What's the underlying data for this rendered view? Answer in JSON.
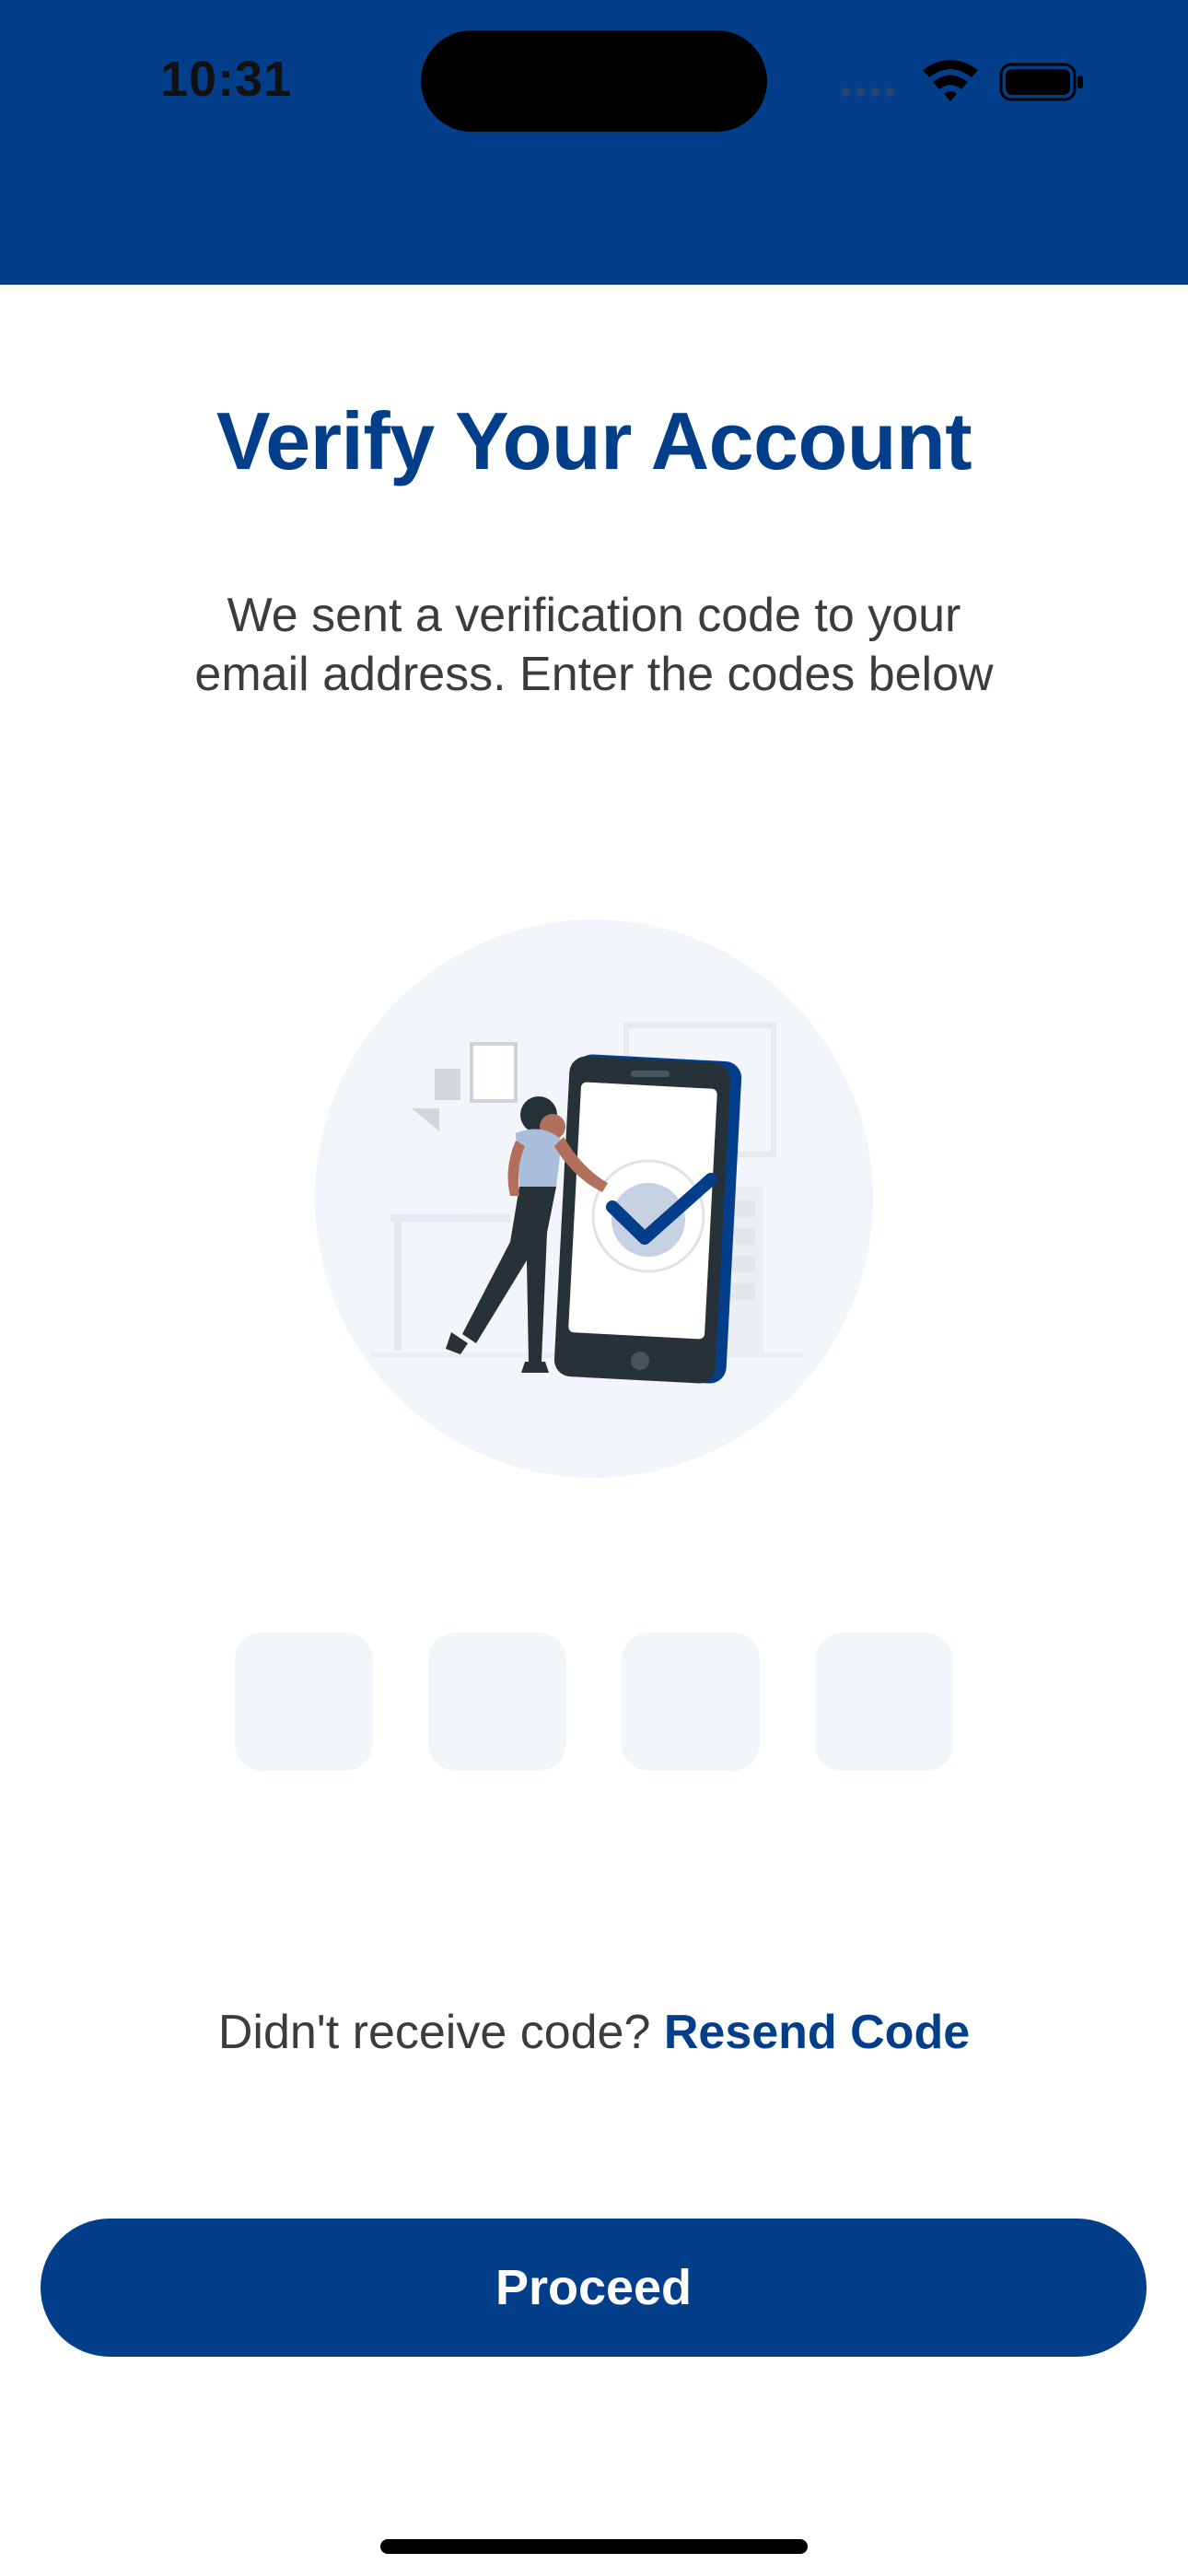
{
  "status_bar": {
    "time": "10:31",
    "icons": [
      "signal-icon",
      "wifi-icon",
      "battery-icon"
    ]
  },
  "title": "Verify Your Account",
  "subtitle": "We sent a verification code to your email address. Enter the codes below",
  "illustration": {
    "icon": "verification-illustration",
    "accent_color": "#033E8A",
    "circle_color": "#F2F5F9"
  },
  "code_inputs": [
    {
      "value": ""
    },
    {
      "value": ""
    },
    {
      "value": ""
    },
    {
      "value": ""
    }
  ],
  "resend": {
    "prompt": "Didn't receive code?",
    "link": "Resend Code"
  },
  "proceed_label": "Proceed",
  "colors": {
    "brand": "#033E8A",
    "input_bg": "#F2F5F9",
    "text": "#3c3c3c"
  }
}
